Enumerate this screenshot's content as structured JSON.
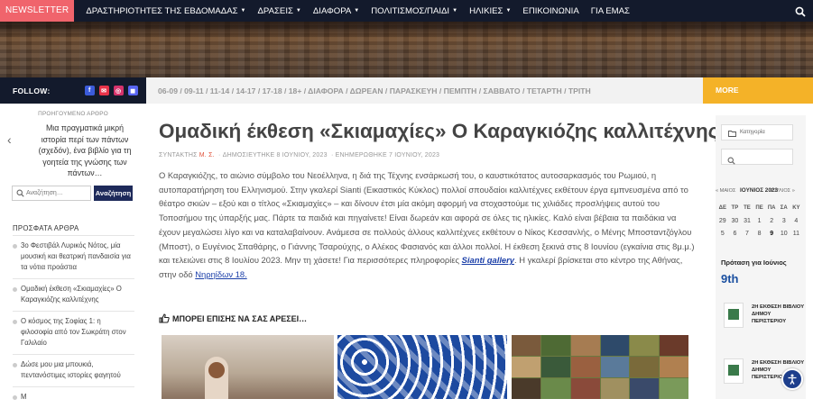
{
  "topnav": {
    "newsletter": "NEWSLETTER",
    "items": [
      {
        "label": "ΔΡΑΣΤΗΡΙΟΤΗΤΕΣ ΤΗΣ ΕΒΔΟΜΑΔΑΣ",
        "caret": true
      },
      {
        "label": "ΔΡΑΣΕΙΣ",
        "caret": true
      },
      {
        "label": "ΔΙΑΦΟΡΑ",
        "caret": true
      },
      {
        "label": "ΠΟΛΙΤΙΣΜΟΣ/ΠΑΙΔΙ",
        "caret": true
      },
      {
        "label": "ΗΛΙΚΙΕΣ",
        "caret": true
      },
      {
        "label": "ΕΠΙΚΟΙΝΩΝΙΑ",
        "caret": false
      },
      {
        "label": "ΓΙΑ ΕΜΑΣ",
        "caret": false
      }
    ],
    "search_icon": "search-icon"
  },
  "follow": {
    "label": "FOLLOW:",
    "socials": [
      {
        "icon": "facebook-icon",
        "glyph": "f",
        "color": "#3b5bdb"
      },
      {
        "icon": "email-icon",
        "glyph": "✉",
        "color": "#e8334a"
      },
      {
        "icon": "instagram-icon",
        "glyph": "◎",
        "color": "#d6336c"
      },
      {
        "icon": "discord-icon",
        "glyph": "◼",
        "color": "#5865f2"
      }
    ]
  },
  "tags_bar": "06-09 / 09-11 / 11-14 / 14-17 / 17-18 / 18+ / ΔΙΑΦΟΡΑ / ΔΩΡΕΑΝ / ΠΑΡΑΣΚΕΥΗ / ΠΕΜΠΤΗ / ΣΑΒΒΑΤΟ / ΤΕΤΑΡΤΗ / ΤΡΙΤΗ",
  "more_label": "MORE",
  "left": {
    "prev_label": "ΠΡΟΗΓΟΥΜΕΝΟ ΑΡΘΡΟ",
    "prev_title": "Μια πραγματικά μικρή ιστορία περί των πάντων (σχεδόν), ένα βιβλίο για τη γοητεία της γνώσης των πάντων…",
    "search_placeholder": "Αναζήτηση…",
    "search_button": "Αναζήτηση",
    "recent_heading": "ΠΡΟΣΦΑΤΑ ΑΡΘΡΑ",
    "recent": [
      "3ο Φεστιβάλ Λυρικός Νότος, μία μουσική και θεατρική πανδαισία για τα νότια προάστια",
      "Ομαδική έκθεση «Σκιαμαχίες» Ο Καραγκιόζης καλλιτέχνης",
      "Ο κόσμος της Σοφίας 1: η φιλοσοφία από τον Σωκράτη στον Γαλιλαίο",
      "Δώσε μου μια μπουκιά, πεντανόστιμες ιστορίες φαγητού",
      "Μ"
    ]
  },
  "article": {
    "title": "Ομαδική έκθεση «Σκιαμαχίες» Ο Καραγκιόζης καλλιτέχνης",
    "meta_author_prefix": "ΣΥΝΤΑΚΤΗΣ ",
    "meta_author": "Μ. Σ.",
    "meta_published": "ΔΗΜΟΣΙΕΥΤΗΚΕ 8 ΙΟΥΝΙΟΥ, 2023",
    "meta_updated": "ΕΝΗΜΕΡΩΘΗΚΕ 7 ΙΟΥΝΙΟΥ, 2023",
    "body_main": "Ο Καραγκιόζης, το αιώνιο σύμβολο του Νεοέλληνα, η διά της Τέχνης ενσάρκωσή του, ο καυστικότατος αυτοσαρκασμός του Ρωμιού, η αυτοπαρατήρηση του Ελληνισμού. Στην γκαλερί Sianti (Εικαστικός Κύκλος) πολλοί σπουδαίοι καλλιτέχνες εκθέτουν έργα εμπνευσμένα από το θέατρο σκιών – εξού και ο τίτλος «Σκιαμαχίες» – και δίνουν έτσι μία ακόμη αφορμή να στοχαστούμε τις χιλιάδες προσλήψεις αυτού του Τοποσήμου της ύπαρξής μας. Πάρτε τα παιδιά και πηγαίνετε! Είναι δωρεάν και αφορά σε όλες τις ηλικίες. Καλό είναι βέβαια τα παιδάκια να έχουν μεγαλώσει λίγο και να καταλαβαίνουν. Ανάμεσα σε πολλούς άλλους καλλιτέχνες εκθέτουν ο Νίκος Κεσσανλής, ο Μένης Μποσταντζόγλου (Μποστ), ο Ευγένιος Σπαθάρης, ο Γιάννης Τσαρούχης, ο Αλέκος Φασιανός και άλλοι πολλοί. Η έκθεση ξεκινά στις 8 Ιουνίου (εγκαίνια στις 8μ.μ.) και τελειώνει στις 8 Ιουλίου 2023. Μην τη χάσετε! Για περισσότερες πληροφορίες ",
    "body_link1": "Sianti gallery",
    "body_mid": ". Η γκαλερί βρίσκεται στο κέντρο της Αθήνας, στην οδό ",
    "body_link2": "Νηρηίδων 18."
  },
  "related": {
    "heading": "ΜΠΟΡΕΙ ΕΠΙΣΗΣ ΝΑ ΣΑΣ ΑΡΕΣΕΙ…",
    "thumb_icon": "thumbs-up-icon"
  },
  "right": {
    "category_placeholder": "Κατηγορία",
    "calendar_prev": "« ΜΑΙΟΣ",
    "calendar_month": "ΙΟΥΝΙΟΣ 2023",
    "calendar_next": "ΙΟΥΛΙΟΣ »",
    "weekdays": [
      "ΔΕ",
      "ΤΡ",
      "ΤΕ",
      "ΠΕ",
      "ΠΑ",
      "ΣΑ",
      "ΚΥ"
    ],
    "weeks": [
      [
        "29",
        "30",
        "31",
        "1",
        "2",
        "3",
        "4"
      ],
      [
        "5",
        "6",
        "7",
        "8",
        "9",
        "10",
        "11"
      ]
    ],
    "proposal_label": "Πρόταση για Ιούνιος",
    "day": "9th",
    "events": [
      "2Η ΕΚΘΕΣΗ ΒΙΒΛΙΟΥ ΔΗΜΟΥ ΠΕΡΙΣΤΕΡΙΟΥ",
      "2Η ΕΚΘΕΣΗ ΒΙΒΛΙΟΥ ΔΗΜΟΥ ΠΕΡΙΣΤΕΡΙΟΥ"
    ]
  },
  "colors": {
    "nav_bg": "#131a2c",
    "newsletter_bg": "#f0646c",
    "more_bg": "#f4b228",
    "link": "#1a3ea8",
    "button_bg": "#1e2a5a"
  }
}
